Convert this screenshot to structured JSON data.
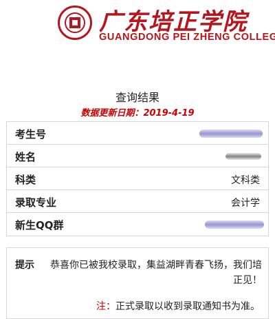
{
  "header": {
    "name_cn": "广东培正学院",
    "name_en": "GUANGDONG PEI ZHENG COLLEGE",
    "brand_color": "#b5151b"
  },
  "result": {
    "title": "查询结果",
    "update_label": "数据更新日期：",
    "update_date": "2019-4-19",
    "rows": [
      {
        "label": "考生号",
        "value": "",
        "redacted": true
      },
      {
        "label": "姓名",
        "value": "",
        "redacted": true
      },
      {
        "label": "科类",
        "value": "文科类"
      },
      {
        "label": "录取专业",
        "value": "会计学"
      },
      {
        "label": "新生QQ群",
        "value": "",
        "redacted": true
      }
    ]
  },
  "notice": {
    "tip_label": "提示",
    "tip_text": "恭喜你已被我校录取，集益湖畔青春飞扬，我们培正见！",
    "note_label": "注：",
    "note_text": "正式录取以收到录取通知书为准。",
    "note_color": "#cc0000"
  }
}
